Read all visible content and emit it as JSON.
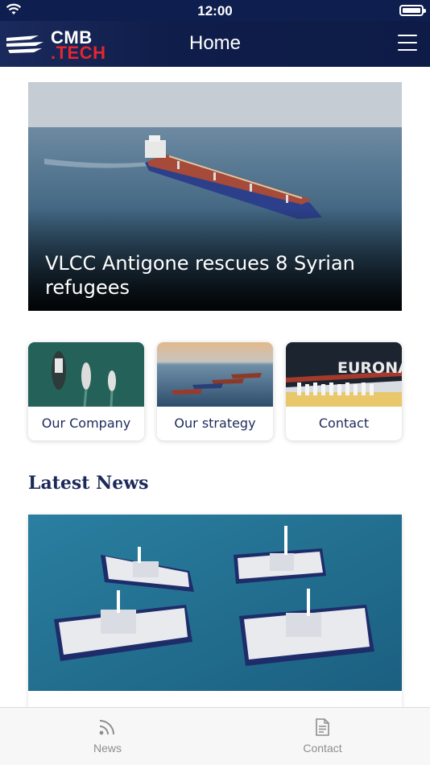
{
  "status_bar": {
    "time": "12:00"
  },
  "nav": {
    "logo_line1": "CMB",
    "logo_line2": ".TECH",
    "title": "Home"
  },
  "hero": {
    "title": "VLCC Antigone rescues 8 Syrian refugees"
  },
  "cards": [
    {
      "label": "Our Company"
    },
    {
      "label": "Our strategy"
    },
    {
      "label": "Contact"
    }
  ],
  "contact_card_image_text": "EURONAV",
  "latest_news": {
    "heading": "Latest News"
  },
  "tab_bar": {
    "news_label": "News",
    "contact_label": "Contact"
  },
  "colors": {
    "navy": "#0e1b47",
    "brand_red": "#e5262f",
    "text_navy": "#1c2a5a"
  }
}
